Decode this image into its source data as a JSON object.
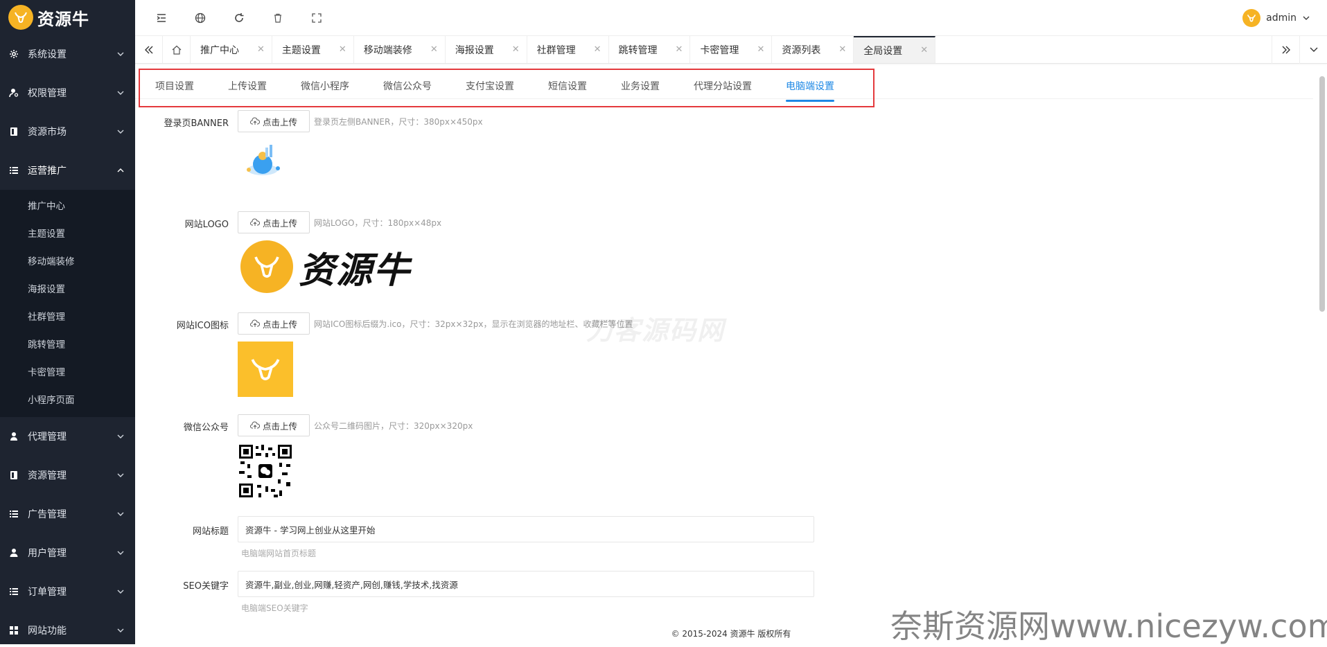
{
  "brand": {
    "logo_text": "资源牛"
  },
  "colors": {
    "sidebar_bg": "#1e2430",
    "accent": "#1e88e5",
    "brand_yellow": "#f6b324",
    "highlight_border": "#e4393c"
  },
  "sidebar": {
    "items": [
      {
        "label": "系统设置",
        "icon": "gear-icon"
      },
      {
        "label": "权限管理",
        "icon": "user-key-icon"
      },
      {
        "label": "资源市场",
        "icon": "book-icon"
      },
      {
        "label": "运营推广",
        "icon": "list-icon",
        "open": true
      },
      {
        "label": "代理管理",
        "icon": "agent-icon"
      },
      {
        "label": "资源管理",
        "icon": "book-icon"
      },
      {
        "label": "广告管理",
        "icon": "list-icon"
      },
      {
        "label": "用户管理",
        "icon": "person-icon"
      },
      {
        "label": "订单管理",
        "icon": "list-icon"
      },
      {
        "label": "网站功能",
        "icon": "grid-icon"
      }
    ],
    "subitems": [
      "推广中心",
      "主题设置",
      "移动端装修",
      "海报设置",
      "社群管理",
      "跳转管理",
      "卡密管理",
      "小程序页面"
    ]
  },
  "header": {
    "username": "admin"
  },
  "page_tabs": [
    "推广中心",
    "主题设置",
    "移动端装修",
    "海报设置",
    "社群管理",
    "跳转管理",
    "卡密管理",
    "资源列表",
    "全局设置"
  ],
  "settings_tabs": [
    "项目设置",
    "上传设置",
    "微信小程序",
    "微信公众号",
    "支付宝设置",
    "短信设置",
    "业务设置",
    "代理分站设置",
    "电脑端设置"
  ],
  "form": {
    "upload_label": "点击上传",
    "banner": {
      "label": "登录页BANNER",
      "hint": "登录页左侧BANNER，尺寸：380px×450px"
    },
    "logo": {
      "label": "网站LOGO",
      "hint": "网站LOGO，尺寸：180px×48px",
      "preview_text": "资源牛"
    },
    "ico": {
      "label": "网站ICO图标",
      "hint": "网站ICO图标后缀为.ico，尺寸：32px×32px，显示在浏览器的地址栏、收藏栏等位置"
    },
    "wechat": {
      "label": "微信公众号",
      "hint": "公众号二维码图片，尺寸：320px×320px"
    },
    "site_title": {
      "label": "网站标题",
      "value": "资源牛 - 学习网上创业从这里开始",
      "hint": "电脑端网站首页标题"
    },
    "seo_keywords": {
      "label": "SEO关键字",
      "value": "资源牛,副业,创业,网赚,轻资产,网创,赚钱,学技术,找资源",
      "hint": "电脑端SEO关键字"
    }
  },
  "footer": {
    "text": "© 2015-2024 资源牛 版权所有"
  },
  "watermarks": {
    "mid": "刀客源码网",
    "corner": "奈斯资源网www.nicezyw.com"
  }
}
